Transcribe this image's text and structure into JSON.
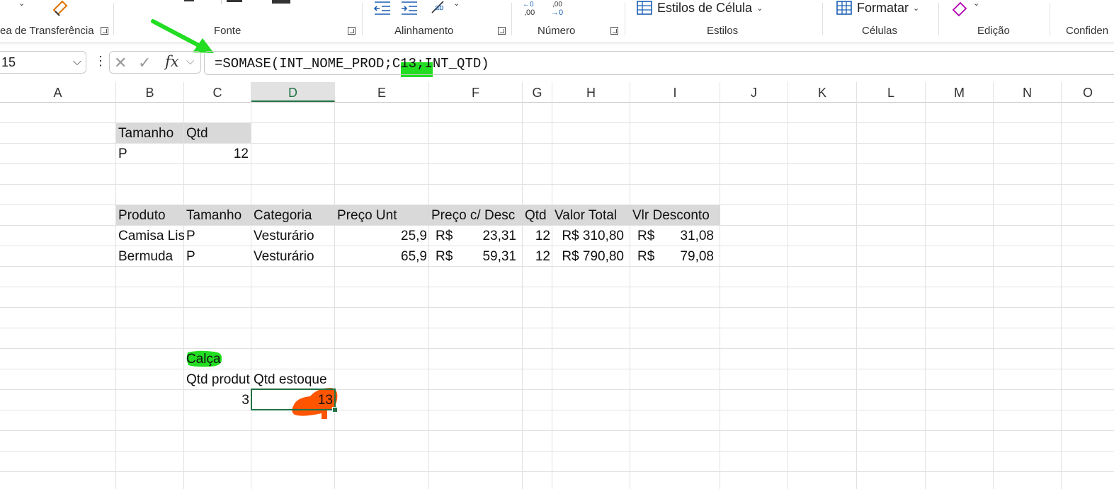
{
  "ribbon": {
    "groups": [
      {
        "label": "ea de Transferência"
      },
      {
        "label": "Fonte"
      },
      {
        "label": "Alinhamento"
      },
      {
        "label": "Número"
      },
      {
        "label": "Estilos"
      },
      {
        "label": "Células"
      },
      {
        "label": "Edição"
      },
      {
        "label": "Confiden"
      }
    ],
    "estilos_button": "Estilos de Célula",
    "formatar_button": "Formatar"
  },
  "formula_bar": {
    "name_box": "15",
    "fx": "fx",
    "formula": "=SOMASE(INT_NOME_PROD;C13;INT_QTD)"
  },
  "columns": [
    "A",
    "B",
    "C",
    "D",
    "E",
    "F",
    "G",
    "H",
    "I",
    "J",
    "K",
    "L",
    "M",
    "N",
    "O"
  ],
  "active_column": "D",
  "sheet": {
    "size_table": {
      "headers": [
        "Tamanho",
        "Qtd"
      ],
      "row": [
        "P",
        "12"
      ]
    },
    "products_table": {
      "headers": [
        "Produto",
        "Tamanho",
        "Categoria",
        "Preço Unt",
        "Preço c/ Desc",
        "Qtd",
        "Valor Total",
        "Vlr Desconto"
      ],
      "rows": [
        {
          "produto": "Camisa Lis",
          "tamanho": "P",
          "categoria": "Vesturário",
          "preco": "25,9",
          "cur1": "R$",
          "desc": "23,31",
          "qtd": "12",
          "total": "R$ 310,80",
          "cur2": "R$",
          "vdesc": "31,08"
        },
        {
          "produto": "Bermuda",
          "tamanho": "P",
          "categoria": "Vesturário",
          "preco": "65,9",
          "cur1": "R$",
          "desc": "59,31",
          "qtd": "12",
          "total": "R$ 790,80",
          "cur2": "R$",
          "vdesc": "79,08"
        }
      ]
    },
    "lookup": {
      "name": "Calça",
      "label_prod": "Qtd produt",
      "label_estoque": "Qtd estoque",
      "qtd_prod": "3",
      "qtd_estoque": "13"
    }
  },
  "colors": {
    "accent": "#217346",
    "highlight_green": "#22dd22",
    "annotation_orange": "#ff5500"
  }
}
